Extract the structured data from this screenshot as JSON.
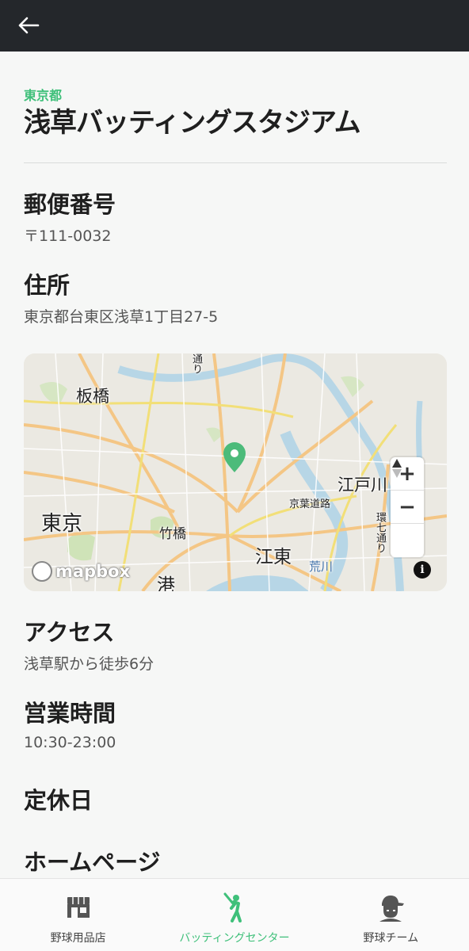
{
  "header": {
    "back_icon": "arrow-left-icon"
  },
  "detail": {
    "prefecture": "東京都",
    "title": "浅草バッティングスタジアム",
    "postal_label": "郵便番号",
    "postal_value": "〒111-0032",
    "address_label": "住所",
    "address_value": "東京都台東区浅草1丁目27-5",
    "access_label": "アクセス",
    "access_value": "浅草駅から徒歩6分",
    "hours_label": "営業時間",
    "hours_value": "10:30-23:00",
    "holiday_label": "定休日",
    "homepage_label": "ホームページ"
  },
  "map": {
    "labels": {
      "itabashi": "板橋",
      "tokyo": "東京",
      "takebashi": "竹橋",
      "koto": "江東",
      "minato": "港",
      "edogawa": "江戸川",
      "keiyo": "京葉道路",
      "arakawa": "荒川",
      "kan7": "環七通り",
      "dori": "通り"
    },
    "zoom_in": "+",
    "zoom_out": "−",
    "compass_icon": "compass-icon",
    "logo": "mapbox",
    "info": "i",
    "pin_color": "#4cbb7a"
  },
  "nav": {
    "items": [
      {
        "label": "野球用品店",
        "icon": "store-icon"
      },
      {
        "label": "バッティングセンター",
        "icon": "batter-icon"
      },
      {
        "label": "野球チーム",
        "icon": "player-cap-icon"
      }
    ],
    "active_color": "#3fc07a"
  }
}
